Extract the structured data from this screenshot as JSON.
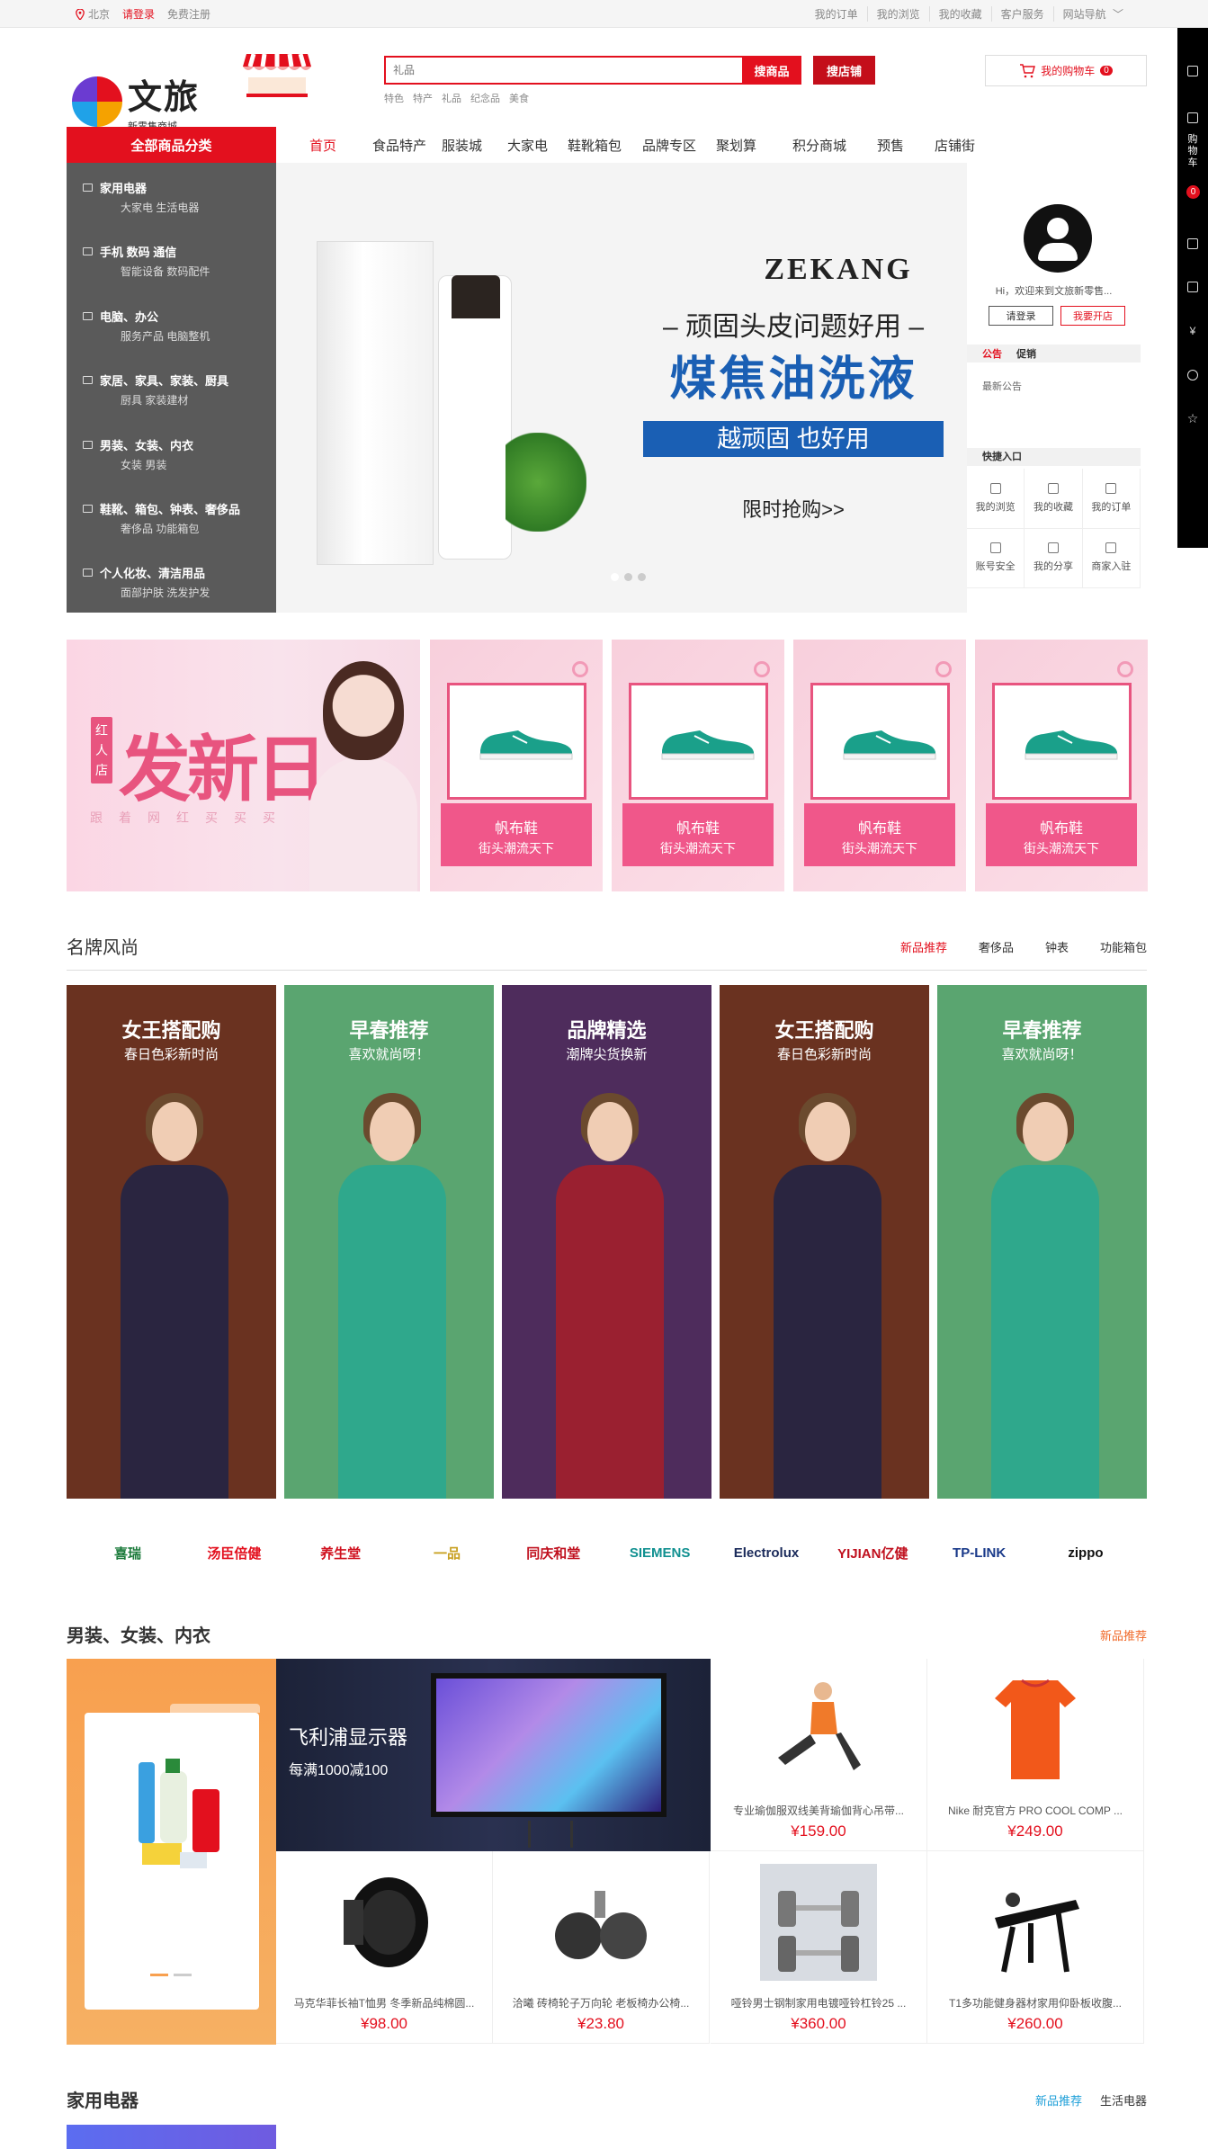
{
  "topbar": {
    "location": "北京",
    "login": "请登录",
    "register": "免费注册",
    "links": [
      "我的订单",
      "我的浏览",
      "我的收藏",
      "客户服务",
      "网站导航"
    ]
  },
  "header": {
    "logo_title": "文旅",
    "logo_sub": "新零售商城",
    "search_placeholder": "礼品",
    "search_goods": "搜商品",
    "search_shop": "搜店铺",
    "hotwords": [
      "特色",
      "特产",
      "礼品",
      "纪念品",
      "美食"
    ],
    "cart_label": "我的购物车",
    "cart_count": "0"
  },
  "nav": {
    "all_categories": "全部商品分类",
    "items": [
      "首页",
      "食品特产",
      "服装城",
      "大家电",
      "鞋靴箱包",
      "品牌专区",
      "聚划算",
      "积分商城",
      "预售",
      "店铺街"
    ]
  },
  "categories": [
    {
      "title": "家用电器",
      "sub": "大家电  生活电器"
    },
    {
      "title": "手机  数码  通信",
      "sub": "智能设备  数码配件"
    },
    {
      "title": "电脑、办公",
      "sub": "服务产品  电脑整机"
    },
    {
      "title": "家居、家具、家装、厨具",
      "sub": "厨具  家装建材"
    },
    {
      "title": "男装、女装、内衣",
      "sub": "女装  男装"
    },
    {
      "title": "鞋靴、箱包、钟表、奢侈品",
      "sub": "奢侈品  功能箱包"
    },
    {
      "title": "个人化妆、清洁用品",
      "sub": "面部护肤  洗发护发"
    }
  ],
  "banner": {
    "brand": "ZEKANG",
    "line1": "– 顽固头皮问题好用 –",
    "line2": "煤焦油洗液",
    "line3": "越顽固 也好用",
    "line4": "限时抢购>>"
  },
  "user": {
    "greeting": "Hi，欢迎来到文旅新零售...",
    "login_btn": "请登录",
    "open_btn": "我要开店",
    "tab_notice": "公告",
    "tab_promo": "促销",
    "notice_text": "最新公告",
    "quick_title": "快捷入口",
    "quick_items": [
      "我的浏览",
      "我的收藏",
      "我的订单",
      "账号安全",
      "我的分享",
      "商家入驻"
    ]
  },
  "sidebar": {
    "cart_label": "购物车",
    "cart_count": "0"
  },
  "promo": {
    "tag": "红人店",
    "title": "发新日",
    "subtitle": "跟着网红买买买",
    "cards": [
      {
        "name": "帆布鞋",
        "desc": "街头潮流天下"
      },
      {
        "name": "帆布鞋",
        "desc": "街头潮流天下"
      },
      {
        "name": "帆布鞋",
        "desc": "街头潮流天下"
      },
      {
        "name": "帆布鞋",
        "desc": "街头潮流天下"
      }
    ]
  },
  "brand_section": {
    "title": "名牌风尚",
    "tabs": [
      "新品推荐",
      "奢侈品",
      "钟表",
      "功能箱包"
    ],
    "panels": [
      {
        "title": "女王搭配购",
        "sub": "春日色彩新时尚",
        "color": "#6a3220",
        "dress": "#2a2540"
      },
      {
        "title": "早春推荐",
        "sub": "喜欢就尚呀！",
        "color": "#5aa570",
        "dress": "#2fa88c"
      },
      {
        "title": "品牌精选",
        "sub": "潮牌尖货换新",
        "color": "#4e2c5c",
        "dress": "#9a2030"
      },
      {
        "title": "女王搭配购",
        "sub": "春日色彩新时尚",
        "color": "#6a3220",
        "dress": "#2a2540"
      },
      {
        "title": "早春推荐",
        "sub": "喜欢就尚呀！",
        "color": "#5aa570",
        "dress": "#2fa88c"
      }
    ]
  },
  "brand_logos": [
    {
      "name": "喜瑞",
      "color": "#1a7a3a"
    },
    {
      "name": "汤臣倍健",
      "color": "#e3101e"
    },
    {
      "name": "养生堂",
      "color": "#d0101e"
    },
    {
      "name": "一品",
      "color": "#c8a020"
    },
    {
      "name": "同庆和堂",
      "color": "#c0101e"
    },
    {
      "name": "SIEMENS",
      "color": "#109090"
    },
    {
      "name": "Electrolux",
      "color": "#1a2a5a"
    },
    {
      "name": "YIJIAN亿健",
      "color": "#c0101e"
    },
    {
      "name": "TP-LINK",
      "color": "#1a3a8a"
    },
    {
      "name": "zippo",
      "color": "#111111"
    }
  ],
  "mens_section": {
    "title": "男装、女装、内衣",
    "tab": "新品推荐",
    "ad_title": "飞利浦显示器",
    "ad_sub": "每满1000减100",
    "products": [
      {
        "name": "专业瑜伽服双线美背瑜伽背心吊带...",
        "price": "¥159.00"
      },
      {
        "name": "Nike 耐克官方 PRO COOL COMP ...",
        "price": "¥249.00"
      },
      {
        "name": "马克华菲长袖T恤男 冬季新品纯棉圆...",
        "price": "¥98.00"
      },
      {
        "name": "洽曦 砖椅轮子万向轮 老板椅办公椅...",
        "price": "¥23.80"
      },
      {
        "name": "哑铃男士钢制家用电镀哑铃杠铃25 ...",
        "price": "¥360.00"
      },
      {
        "name": "T1多功能健身器材家用仰卧板收腹...",
        "price": "¥260.00"
      }
    ]
  },
  "home_section": {
    "title": "家用电器",
    "tabs": [
      "新品推荐",
      "生活电器"
    ]
  }
}
